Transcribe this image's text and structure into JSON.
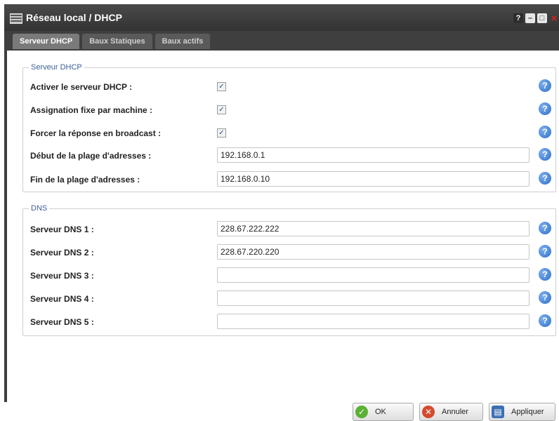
{
  "window": {
    "title": "Réseau local / DHCP",
    "controls": {
      "help": "?",
      "minimize": "–",
      "maximize": "□",
      "close": "×"
    },
    "icons": {
      "app": "network-grid-icon",
      "help": "help-icon",
      "minimize": "minimize-icon",
      "maximize": "maximize-icon",
      "close": "close-icon"
    }
  },
  "tabs": [
    {
      "label": "Serveur DHCP",
      "active": true
    },
    {
      "label": "Baux Statiques",
      "active": false
    },
    {
      "label": "Baux actifs",
      "active": false
    }
  ],
  "dhcp_section": {
    "legend": "Serveur DHCP",
    "rows": [
      {
        "label": "Activer le serveur DHCP :",
        "type": "checkbox",
        "checked": true
      },
      {
        "label": "Assignation fixe par machine :",
        "type": "checkbox",
        "checked": true
      },
      {
        "label": "Forcer la réponse en broadcast :",
        "type": "checkbox",
        "checked": true
      },
      {
        "label": "Début de la plage d'adresses :",
        "type": "text",
        "value": "192.168.0.1"
      },
      {
        "label": "Fin de la plage d'adresses :",
        "type": "text",
        "value": "192.168.0.10"
      }
    ]
  },
  "dns_section": {
    "legend": "DNS",
    "rows": [
      {
        "label": "Serveur DNS 1 :",
        "value": "228.67.222.222"
      },
      {
        "label": "Serveur DNS 2 :",
        "value": "228.67.220.220"
      },
      {
        "label": "Serveur DNS 3 :",
        "value": ""
      },
      {
        "label": "Serveur DNS 4 :",
        "value": ""
      },
      {
        "label": "Serveur DNS 5 :",
        "value": ""
      }
    ]
  },
  "help_glyph": "?",
  "check_glyph": "✓",
  "buttons": {
    "ok": "OK",
    "cancel": "Annuler",
    "apply": "Appliquer",
    "glyphs": {
      "ok": "✓",
      "cancel": "✕",
      "apply": "▤"
    }
  },
  "colors": {
    "title_bar": "#3f3f3f",
    "tab_active": "#7a7a7a",
    "legend": "#3c5f9a",
    "help_icon": "#2c6cc5",
    "ok_icon": "#5bb135",
    "cancel_icon": "#d5492d",
    "apply_icon": "#3a70b3"
  }
}
